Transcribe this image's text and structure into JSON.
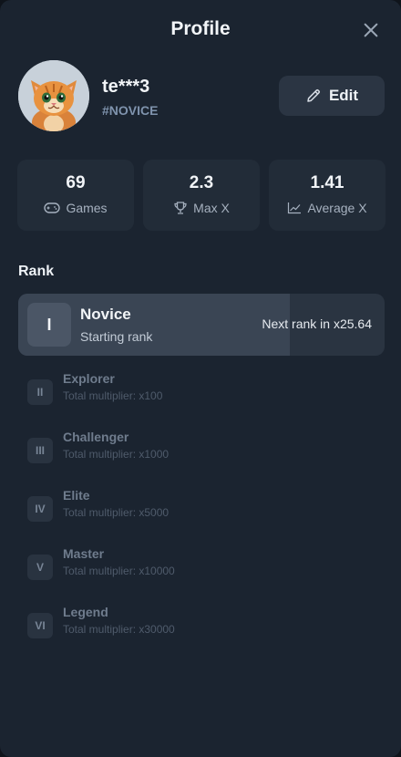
{
  "header": {
    "title": "Profile"
  },
  "user": {
    "name": "te***3",
    "tag": "#NOVICE",
    "edit_label": "Edit"
  },
  "stats": [
    {
      "value": "69",
      "label": "Games",
      "icon": "gamepad-icon"
    },
    {
      "value": "2.3",
      "label": "Max X",
      "icon": "trophy-icon"
    },
    {
      "value": "1.41",
      "label": "Average X",
      "icon": "chart-line-icon"
    }
  ],
  "rank": {
    "heading": "Rank",
    "current": {
      "numeral": "I",
      "name": "Novice",
      "subtitle": "Starting rank",
      "next_text": "Next rank in x25.64"
    },
    "levels": [
      {
        "numeral": "II",
        "name": "Explorer",
        "multiplier": "Total multiplier: x100"
      },
      {
        "numeral": "III",
        "name": "Challenger",
        "multiplier": "Total multiplier: x1000"
      },
      {
        "numeral": "IV",
        "name": "Elite",
        "multiplier": "Total multiplier: x5000"
      },
      {
        "numeral": "V",
        "name": "Master",
        "multiplier": "Total multiplier: x10000"
      },
      {
        "numeral": "VI",
        "name": "Legend",
        "multiplier": "Total multiplier: x30000"
      }
    ]
  },
  "colors": {
    "background": "#1b2430",
    "card": "#222c38",
    "accent_text": "#7f93ad"
  }
}
